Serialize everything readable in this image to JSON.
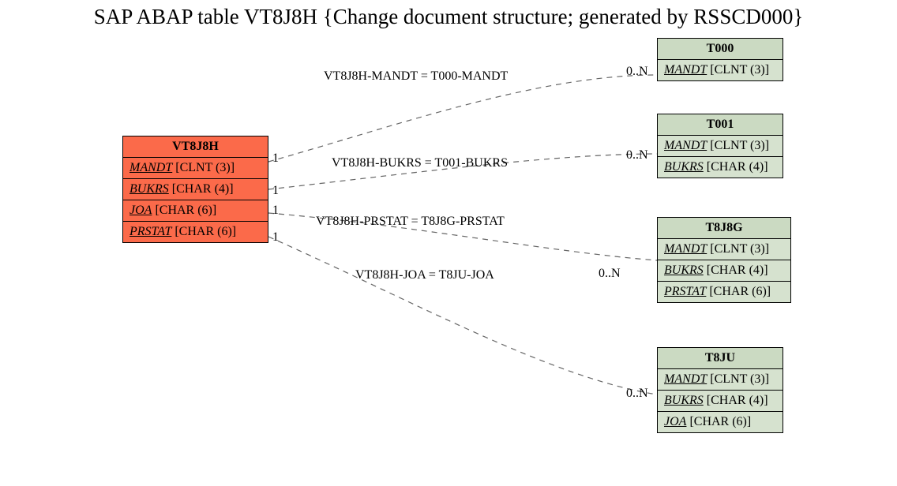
{
  "title": "SAP ABAP table VT8J8H {Change document structure; generated by RSSCD000}",
  "main": {
    "name": "VT8J8H",
    "fields": [
      {
        "fname": "MANDT",
        "ftype": "[CLNT (3)]"
      },
      {
        "fname": "BUKRS",
        "ftype": "[CHAR (4)]"
      },
      {
        "fname": "JOA",
        "ftype": "[CHAR (6)]"
      },
      {
        "fname": "PRSTAT",
        "ftype": "[CHAR (6)]"
      }
    ]
  },
  "targets": [
    {
      "name": "T000",
      "fields": [
        {
          "fname": "MANDT",
          "ftype": "[CLNT (3)]"
        }
      ]
    },
    {
      "name": "T001",
      "fields": [
        {
          "fname": "MANDT",
          "ftype": "[CLNT (3)]"
        },
        {
          "fname": "BUKRS",
          "ftype": "[CHAR (4)]"
        }
      ]
    },
    {
      "name": "T8J8G",
      "fields": [
        {
          "fname": "MANDT",
          "ftype": "[CLNT (3)]"
        },
        {
          "fname": "BUKRS",
          "ftype": "[CHAR (4)]"
        },
        {
          "fname": "PRSTAT",
          "ftype": "[CHAR (6)]"
        }
      ]
    },
    {
      "name": "T8JU",
      "fields": [
        {
          "fname": "MANDT",
          "ftype": "[CLNT (3)]"
        },
        {
          "fname": "BUKRS",
          "ftype": "[CHAR (4)]"
        },
        {
          "fname": "JOA",
          "ftype": "[CHAR (6)]"
        }
      ]
    }
  ],
  "relations": [
    {
      "label": "VT8J8H-MANDT = T000-MANDT",
      "left_card": "1",
      "right_card": "0..N"
    },
    {
      "label": "VT8J8H-BUKRS = T001-BUKRS",
      "left_card": "1",
      "right_card": "0..N"
    },
    {
      "label": "VT8J8H-PRSTAT = T8J8G-PRSTAT",
      "left_card": "1",
      "right_card": ""
    },
    {
      "label": "VT8J8H-JOA = T8JU-JOA",
      "left_card": "1",
      "right_card": "0..N"
    }
  ],
  "extra_right_card": "0..N"
}
